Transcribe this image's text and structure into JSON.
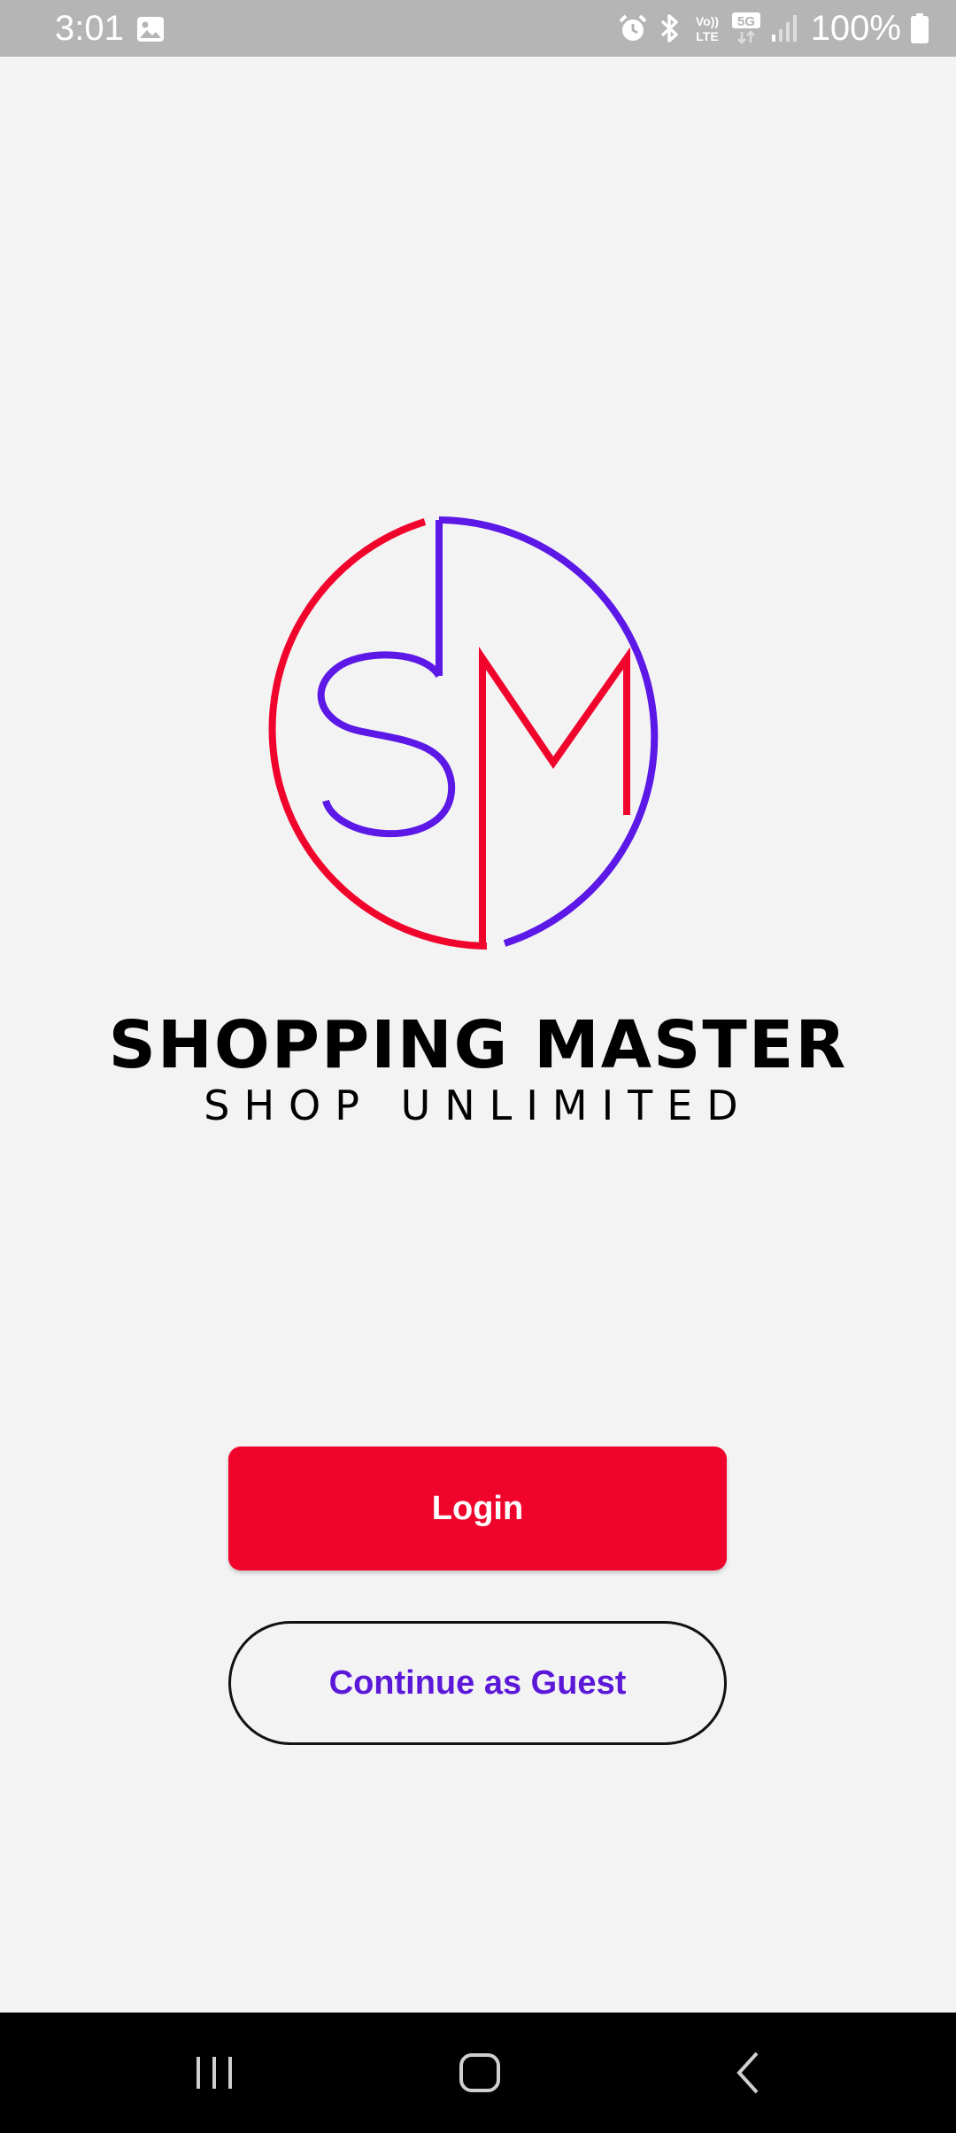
{
  "status_bar": {
    "time": "3:01",
    "battery": "100%",
    "icons": [
      "gallery-icon",
      "alarm-icon",
      "bluetooth-icon",
      "volte-icon",
      "5g-icon",
      "signal-icon",
      "battery-icon"
    ],
    "volte_top": "Vo))",
    "volte_bottom": "LTE",
    "network": "5G"
  },
  "logo": {
    "letters": "SM",
    "colors": {
      "red": "#f0042c",
      "purple": "#5b18e6"
    }
  },
  "brand": {
    "title": "SHOPPING MASTER",
    "tagline": "SHOP UNLIMITED"
  },
  "actions": {
    "login_label": "Login",
    "guest_label": "Continue as Guest"
  },
  "colors": {
    "primary": "#f0042c",
    "accent": "#5b18d9",
    "background": "#f4f3f4"
  },
  "nav_bar": {
    "items": [
      "recent-apps-icon",
      "home-icon",
      "back-icon"
    ]
  }
}
